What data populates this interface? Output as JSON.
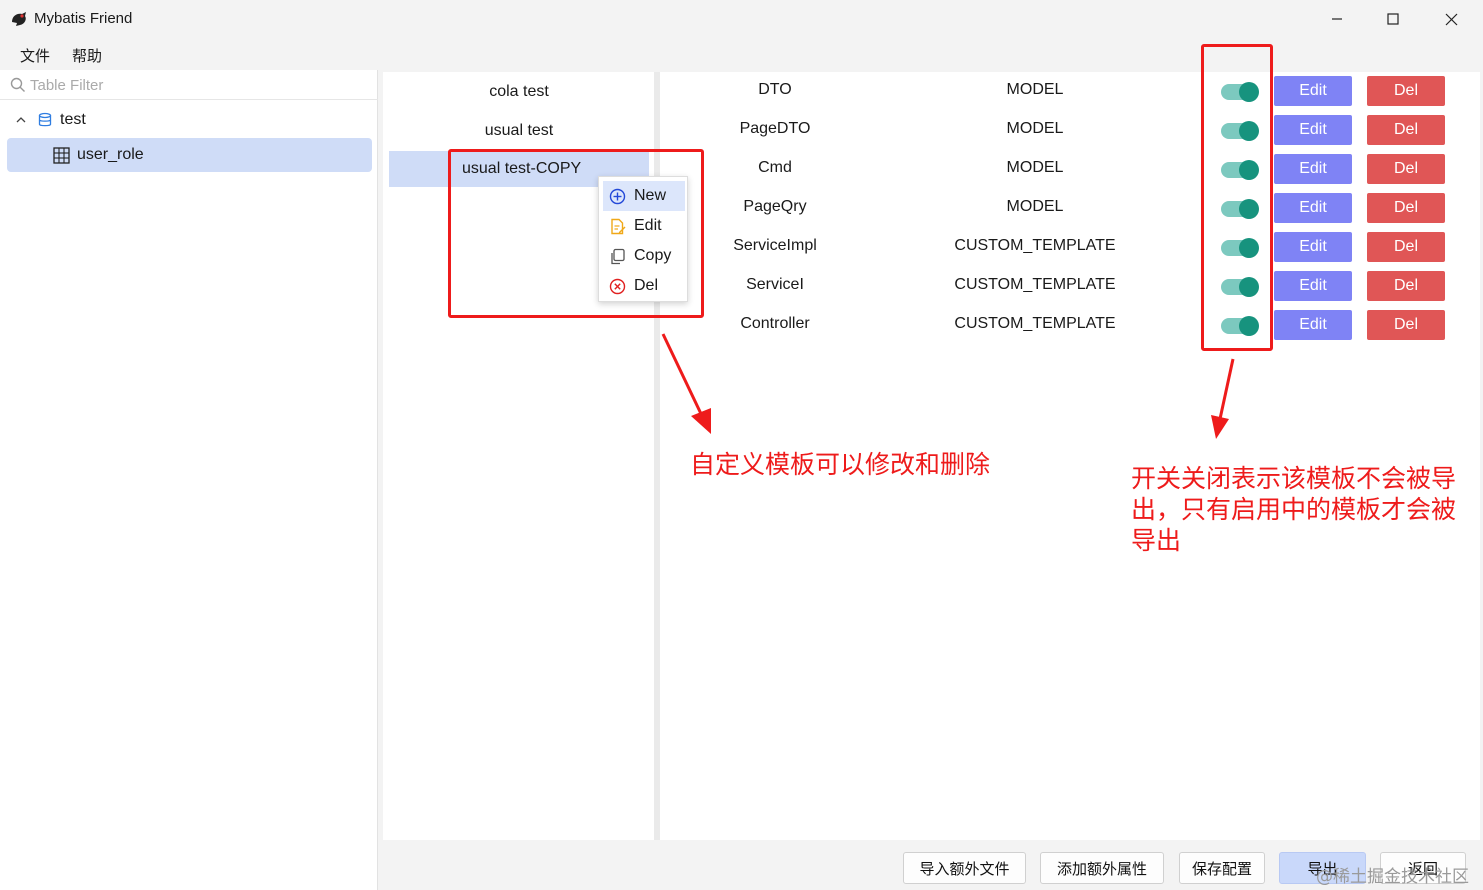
{
  "window": {
    "title": "Mybatis Friend"
  },
  "menu": {
    "items": [
      "文件",
      "帮助"
    ]
  },
  "left_panel": {
    "filter_placeholder": "Table Filter",
    "tree": [
      {
        "label": "test",
        "icon": "database-icon",
        "expanded": true
      },
      {
        "label": "user_role",
        "icon": "table-icon",
        "selected": true
      }
    ]
  },
  "template_groups": {
    "items": [
      {
        "label": "cola test"
      },
      {
        "label": "usual test"
      },
      {
        "label": "usual test-COPY",
        "selected": true
      }
    ]
  },
  "context_menu": {
    "items": [
      {
        "label": "New",
        "icon": "plus-circle-icon"
      },
      {
        "label": "Edit",
        "icon": "edit-doc-icon"
      },
      {
        "label": "Copy",
        "icon": "copy-icon"
      },
      {
        "label": "Del",
        "icon": "x-circle-icon"
      }
    ]
  },
  "templates": {
    "edit_label": "Edit",
    "del_label": "Del",
    "rows": [
      {
        "name": "DTO",
        "type": "MODEL",
        "enabled": true
      },
      {
        "name": "PageDTO",
        "type": "MODEL",
        "enabled": true
      },
      {
        "name": "Cmd",
        "type": "MODEL",
        "enabled": true
      },
      {
        "name": "PageQry",
        "type": "MODEL",
        "enabled": true
      },
      {
        "name": "ServiceImpl",
        "type": "CUSTOM_TEMPLATE",
        "enabled": true
      },
      {
        "name": "ServiceI",
        "type": "CUSTOM_TEMPLATE",
        "enabled": true
      },
      {
        "name": "Controller",
        "type": "CUSTOM_TEMPLATE",
        "enabled": true
      }
    ]
  },
  "bottom_bar": {
    "import_extra_files": "导入额外文件",
    "add_extra_attributes": "添加额外属性",
    "save_config": "保存配置",
    "export": "导出",
    "back": "返回"
  },
  "annotations": {
    "left_note": "自定义模板可以修改和删除",
    "right_note_lines": [
      "开关关闭表示该模板不会被导",
      "出，只有启用中的模板才会被",
      "导出"
    ]
  },
  "watermark": "@稀土掘金技术社区",
  "colors": {
    "edit_button": "#7f83f5",
    "del_button": "#e05656",
    "toggle_on": "#17937e",
    "selection": "#cfdcf7",
    "annotation_red": "#ee1b1b"
  }
}
